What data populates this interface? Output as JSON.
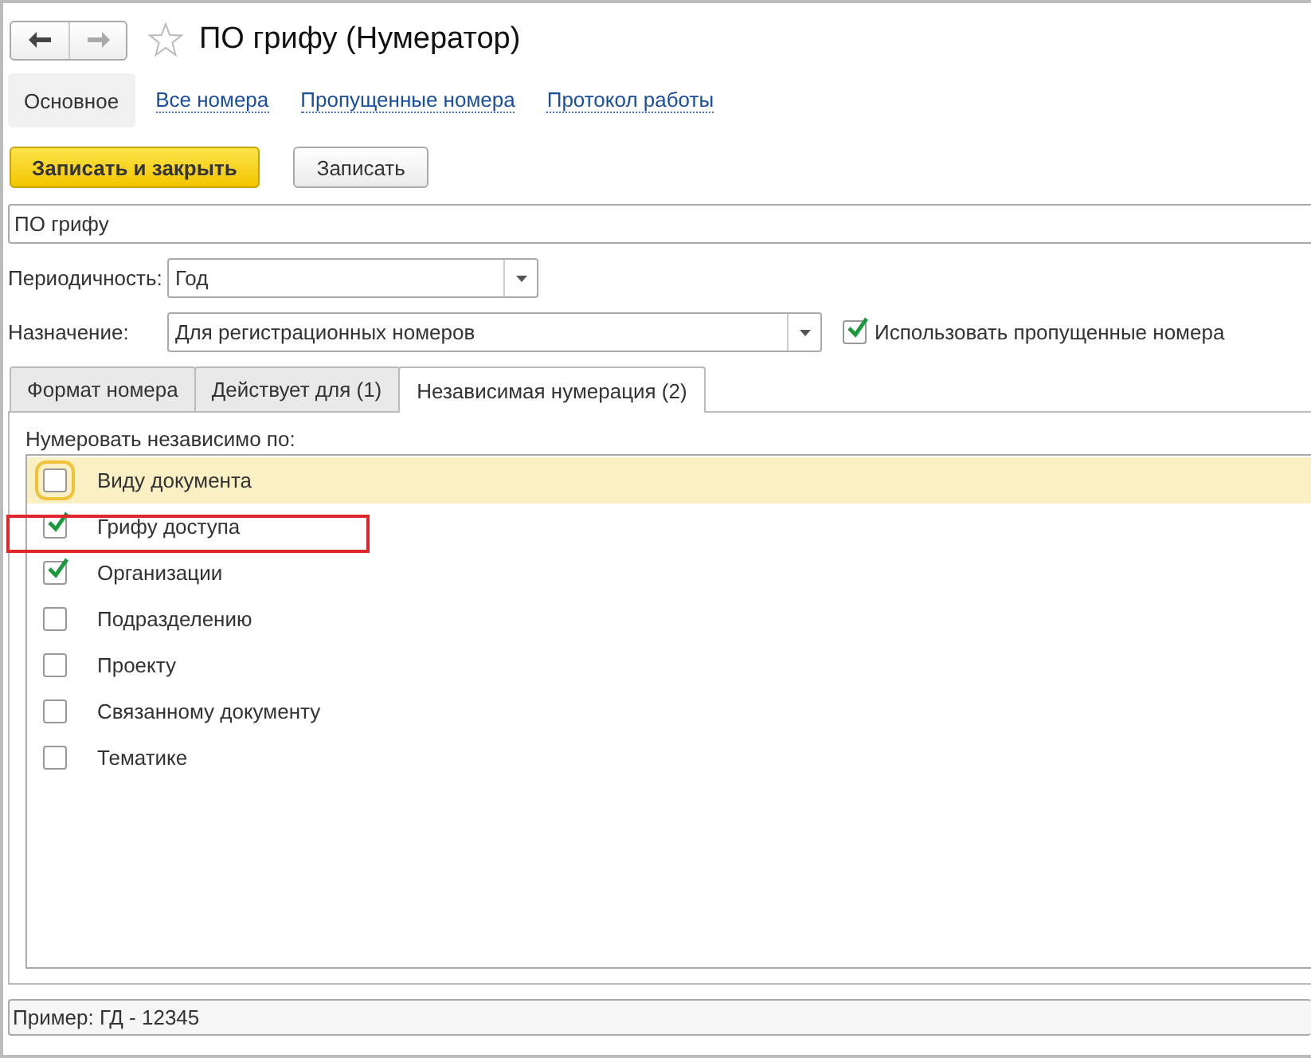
{
  "window": {
    "title": "ПО грифу (Нумератор)",
    "favorite": false
  },
  "nav_tabs": [
    {
      "label": "Основное",
      "selected": true
    },
    {
      "label": "Все номера",
      "selected": false
    },
    {
      "label": "Пропущенные номера",
      "selected": false
    },
    {
      "label": "Протокол работы",
      "selected": false
    }
  ],
  "buttons": [
    {
      "label": "Записать и закрыть",
      "kind": "primary"
    },
    {
      "label": "Записать",
      "kind": "default"
    }
  ],
  "name_field": {
    "value": "ПО грифу"
  },
  "periodicity": {
    "label": "Периодичность:",
    "value": "Год"
  },
  "purpose": {
    "label": "Назначение:",
    "value": "Для регистрационных номеров"
  },
  "use_skipped": {
    "label": "Использовать пропущенные номера",
    "checked": true
  },
  "tabs": [
    {
      "label": "Формат номера",
      "selected": false
    },
    {
      "label": "Действует для (1)",
      "selected": false
    },
    {
      "label": "Независимая нумерация (2)",
      "selected": true
    }
  ],
  "list_caption": "Нумеровать независимо по:",
  "items": [
    {
      "label": "Виду документа",
      "checked": false,
      "selected": true,
      "highlighted": false
    },
    {
      "label": "Грифу доступа",
      "checked": true,
      "selected": false,
      "highlighted": true
    },
    {
      "label": "Организации",
      "checked": true,
      "selected": false,
      "highlighted": false
    },
    {
      "label": "Подразделению",
      "checked": false,
      "selected": false,
      "highlighted": false
    },
    {
      "label": "Проекту",
      "checked": false,
      "selected": false,
      "highlighted": false
    },
    {
      "label": "Связанному документу",
      "checked": false,
      "selected": false,
      "highlighted": false
    },
    {
      "label": "Тематике",
      "checked": false,
      "selected": false,
      "highlighted": false
    }
  ],
  "example": "Пример: ГД - 12345"
}
